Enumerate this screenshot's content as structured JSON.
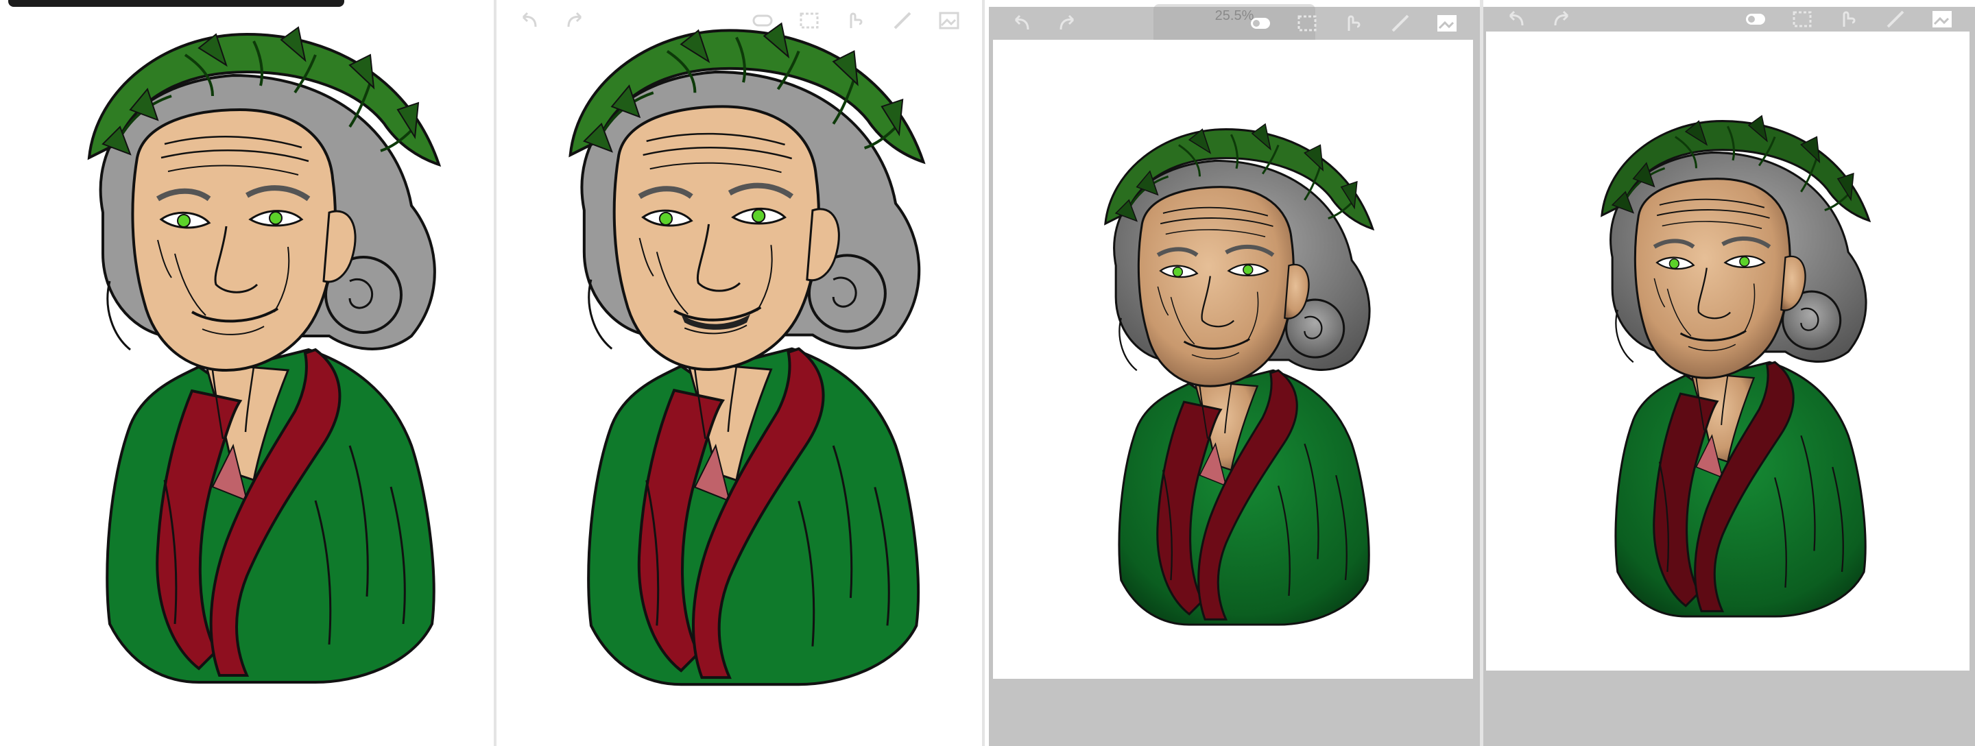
{
  "panels": [
    {
      "name": "stage-1-flat-colors",
      "toolbar_visible": false
    },
    {
      "name": "stage-2-flat-colors-teeth",
      "toolbar_visible": true
    },
    {
      "name": "stage-3-shaded",
      "toolbar_visible": true,
      "zoom_text": "25.5%"
    },
    {
      "name": "stage-4-shaded-final",
      "toolbar_visible": true
    }
  ],
  "toolbar": {
    "icons": [
      "undo-icon",
      "redo-icon",
      "layers-icon",
      "selection-icon",
      "lasso-icon",
      "pen-icon",
      "image-icon"
    ]
  },
  "colors": {
    "wreath": "#2f7d23",
    "wreath_dark": "#1f5c17",
    "hair": "#9a9a9a",
    "skin": "#e8be94",
    "robe_green": "#0f7a2b",
    "robe_red": "#8e0f1f",
    "eye_green": "#5cd22a",
    "toolbar_gray": "#c3c3c3"
  }
}
